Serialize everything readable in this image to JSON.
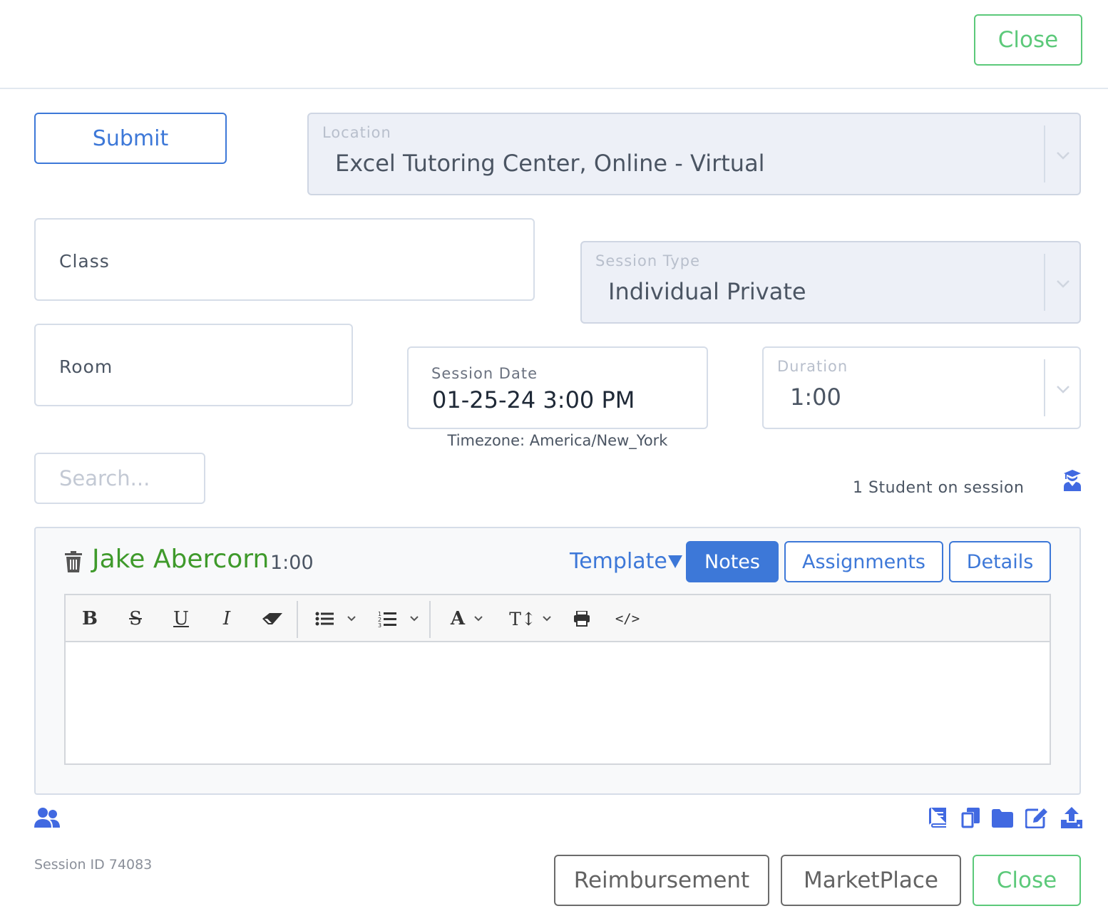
{
  "header": {
    "close_label": "Close"
  },
  "form": {
    "submit_label": "Submit",
    "location": {
      "label": "Location",
      "value": "Excel Tutoring Center, Online - Virtual"
    },
    "class": {
      "placeholder": "Class"
    },
    "session_type": {
      "label": "Session Type",
      "value": "Individual Private"
    },
    "room": {
      "placeholder": "Room"
    },
    "session_date": {
      "label": "Session Date",
      "value": "01-25-24 3:00 PM"
    },
    "timezone": "Timezone: America/New_York",
    "duration": {
      "label": "Duration",
      "value": "1:00"
    }
  },
  "students": {
    "search_placeholder": "Search...",
    "count_text": "1 Student on session"
  },
  "student_card": {
    "name": "Jake Abercorn",
    "duration": "1:00",
    "template_label": "Template",
    "tabs": [
      "Notes",
      "Assignments",
      "Details"
    ],
    "active_tab": "Notes",
    "editor_content": ""
  },
  "footer": {
    "session_id": "Session ID 74083",
    "reimbursement_label": "Reimbursement",
    "marketplace_label": "MarketPlace",
    "close_label": "Close"
  },
  "colors": {
    "accent_blue": "#3d78d8",
    "accent_green": "#5cc97a",
    "student_name_green": "#3f9a2b",
    "icon_blue": "#4169e1"
  },
  "icons": {
    "student_panel": "graduate-icon",
    "delete": "trash-icon",
    "group": "users-icon",
    "actions": [
      "book-icon",
      "copy-icon",
      "folder-icon",
      "edit-icon",
      "upload-icon"
    ],
    "toolbar": [
      "bold-icon",
      "strikethrough-icon",
      "underline-icon",
      "italic-icon",
      "eraser-icon",
      "unordered-list-icon",
      "ordered-list-icon",
      "font-color-icon",
      "font-size-icon",
      "print-icon",
      "code-view-icon"
    ]
  }
}
